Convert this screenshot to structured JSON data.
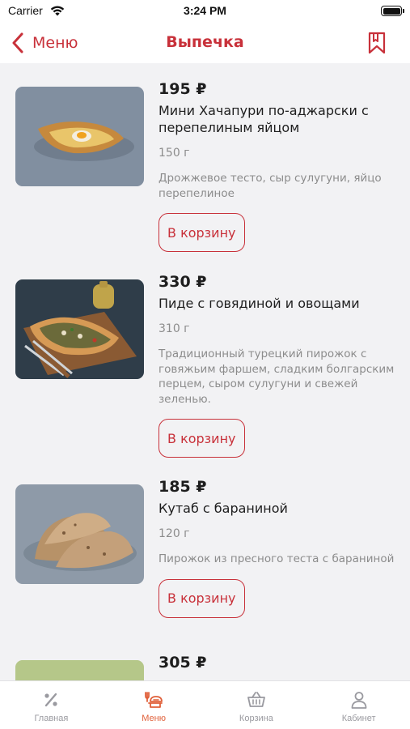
{
  "status_bar": {
    "carrier": "Carrier",
    "time": "3:24 PM"
  },
  "nav": {
    "back_label": "Меню",
    "title": "Выпечка"
  },
  "products": [
    {
      "price": "195 ₽",
      "name": "Мини Хачапури по-аджарски с перепелиным яйцом",
      "weight": "150 г",
      "description": "Дрожжевое тесто, сыр сулугуни, яйцо перепелиное",
      "button_label": "В корзину"
    },
    {
      "price": "330 ₽",
      "name": "Пиде с говядиной и овощами",
      "weight": "310 г",
      "description": "Традиционный турецкий пирожок с говяжьим фаршем, сладким болгарским перцем, сыром сулугуни и свежей зеленью.",
      "button_label": "В корзину"
    },
    {
      "price": "185 ₽",
      "name": "Кутаб с бараниной",
      "weight": "120 г",
      "description": "Пирожок из пресного теста с бараниной",
      "button_label": "В корзину"
    },
    {
      "price": "305 ₽"
    }
  ],
  "tab_bar": {
    "tabs": [
      {
        "label": "Главная",
        "icon": "discount-icon"
      },
      {
        "label": "Меню",
        "icon": "menu-food-icon"
      },
      {
        "label": "Корзина",
        "icon": "basket-icon"
      },
      {
        "label": "Кабинет",
        "icon": "profile-icon"
      }
    ],
    "active_tab": "Меню"
  },
  "colors": {
    "accent": "#c8313a",
    "active_tab": "#e0603a",
    "background": "#f2f2f4"
  }
}
